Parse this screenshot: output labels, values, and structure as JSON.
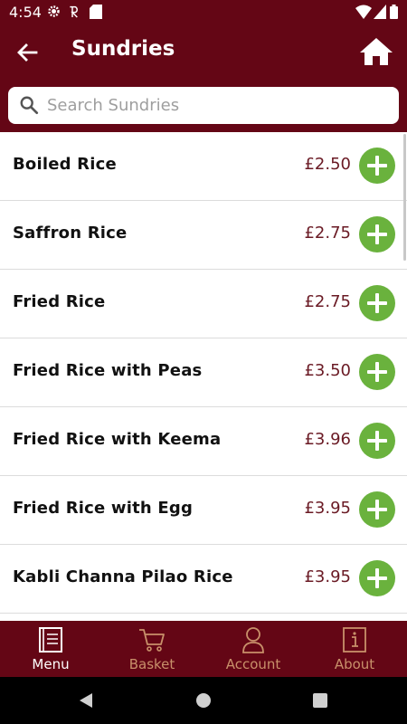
{
  "status_bar": {
    "time": "4:54"
  },
  "header": {
    "title": "Sundries"
  },
  "search": {
    "placeholder": "Search Sundries",
    "value": ""
  },
  "items": [
    {
      "name": "Boiled Rice",
      "price": "£2.50"
    },
    {
      "name": "Saffron Rice",
      "price": "£2.75"
    },
    {
      "name": "Fried Rice",
      "price": "£2.75"
    },
    {
      "name": "Fried Rice with Peas",
      "price": "£3.50"
    },
    {
      "name": "Fried Rice with Keema",
      "price": "£3.96"
    },
    {
      "name": "Fried Rice with Egg",
      "price": "£3.95"
    },
    {
      "name": "Kabli Channa Pilao Rice",
      "price": "£3.95"
    }
  ],
  "bottom_nav": [
    {
      "label": "Menu",
      "icon": "menu-book-icon",
      "active": true
    },
    {
      "label": "Basket",
      "icon": "cart-icon",
      "active": false
    },
    {
      "label": "Account",
      "icon": "person-icon",
      "active": false
    },
    {
      "label": "About",
      "icon": "info-icon",
      "active": false
    }
  ],
  "colors": {
    "brand": "#640615",
    "add_button": "#6ab23d",
    "price": "#6a1a24",
    "nav_inactive": "#c8906a"
  }
}
